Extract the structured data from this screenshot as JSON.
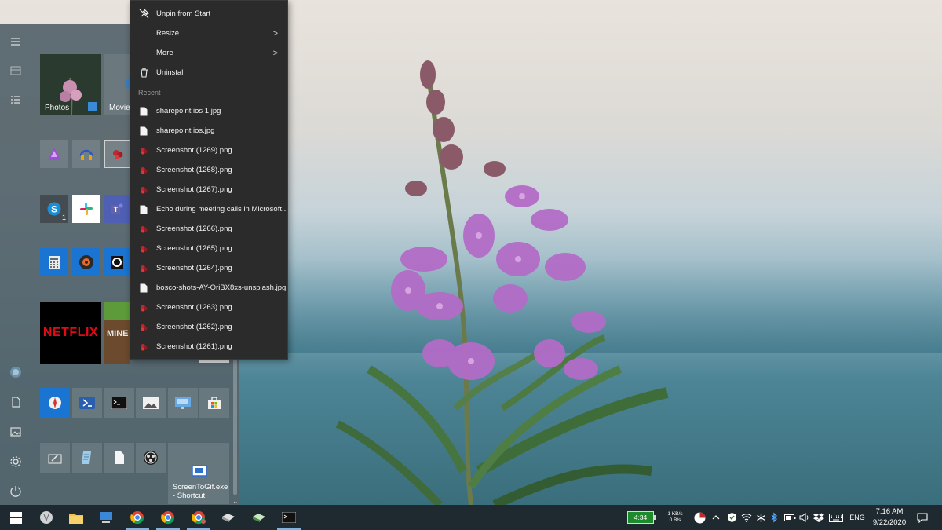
{
  "context_menu": {
    "items": [
      {
        "label": "Unpin from Start",
        "icon": "unpin-icon"
      },
      {
        "label": "Resize",
        "icon": "",
        "chevron": ">"
      },
      {
        "label": "More",
        "icon": "",
        "chevron": ">"
      },
      {
        "label": "Uninstall",
        "icon": "trash-icon"
      }
    ],
    "recent_header": "Recent",
    "recent": [
      {
        "label": "sharepoint ios 1.jpg",
        "icon": "document-icon"
      },
      {
        "label": "sharepoint ios.jpg",
        "icon": "document-icon"
      },
      {
        "label": "Screenshot (1269).png",
        "icon": "image-file-icon"
      },
      {
        "label": "Screenshot (1268).png",
        "icon": "image-file-icon"
      },
      {
        "label": "Screenshot (1267).png",
        "icon": "image-file-icon"
      },
      {
        "label": "Echo during meeting calls in Microsoft...",
        "icon": "document-icon"
      },
      {
        "label": "Screenshot (1266).png",
        "icon": "image-file-icon"
      },
      {
        "label": "Screenshot (1265).png",
        "icon": "image-file-icon"
      },
      {
        "label": "Screenshot (1264).png",
        "icon": "image-file-icon"
      },
      {
        "label": "bosco-shots-AY-OriBX8xs-unsplash.jpg",
        "icon": "document-icon"
      },
      {
        "label": "Screenshot (1263).png",
        "icon": "image-file-icon"
      },
      {
        "label": "Screenshot (1262).png",
        "icon": "image-file-icon"
      },
      {
        "label": "Screenshot (1261).png",
        "icon": "image-file-icon"
      }
    ]
  },
  "tiles": {
    "photos": "Photos",
    "movies": "Movie",
    "skype_badge": "1",
    "netflix": "NETFLIX",
    "minecraft": "MINE",
    "screentogif_line1": "ScreenToGif.exe",
    "screentogif_line2": "- Shortcut"
  },
  "tray": {
    "battery": "4:34",
    "net_up": "1 KB/s",
    "net_down": "0 B/s",
    "language": "ENG",
    "time": "7:16 AM",
    "date": "9/22/2020"
  },
  "colors": {
    "menu_bg": "#2b2b2b",
    "start_bg": "#55646c",
    "taskbar_bg": "#1f2a30",
    "accent": "#0078d7"
  }
}
